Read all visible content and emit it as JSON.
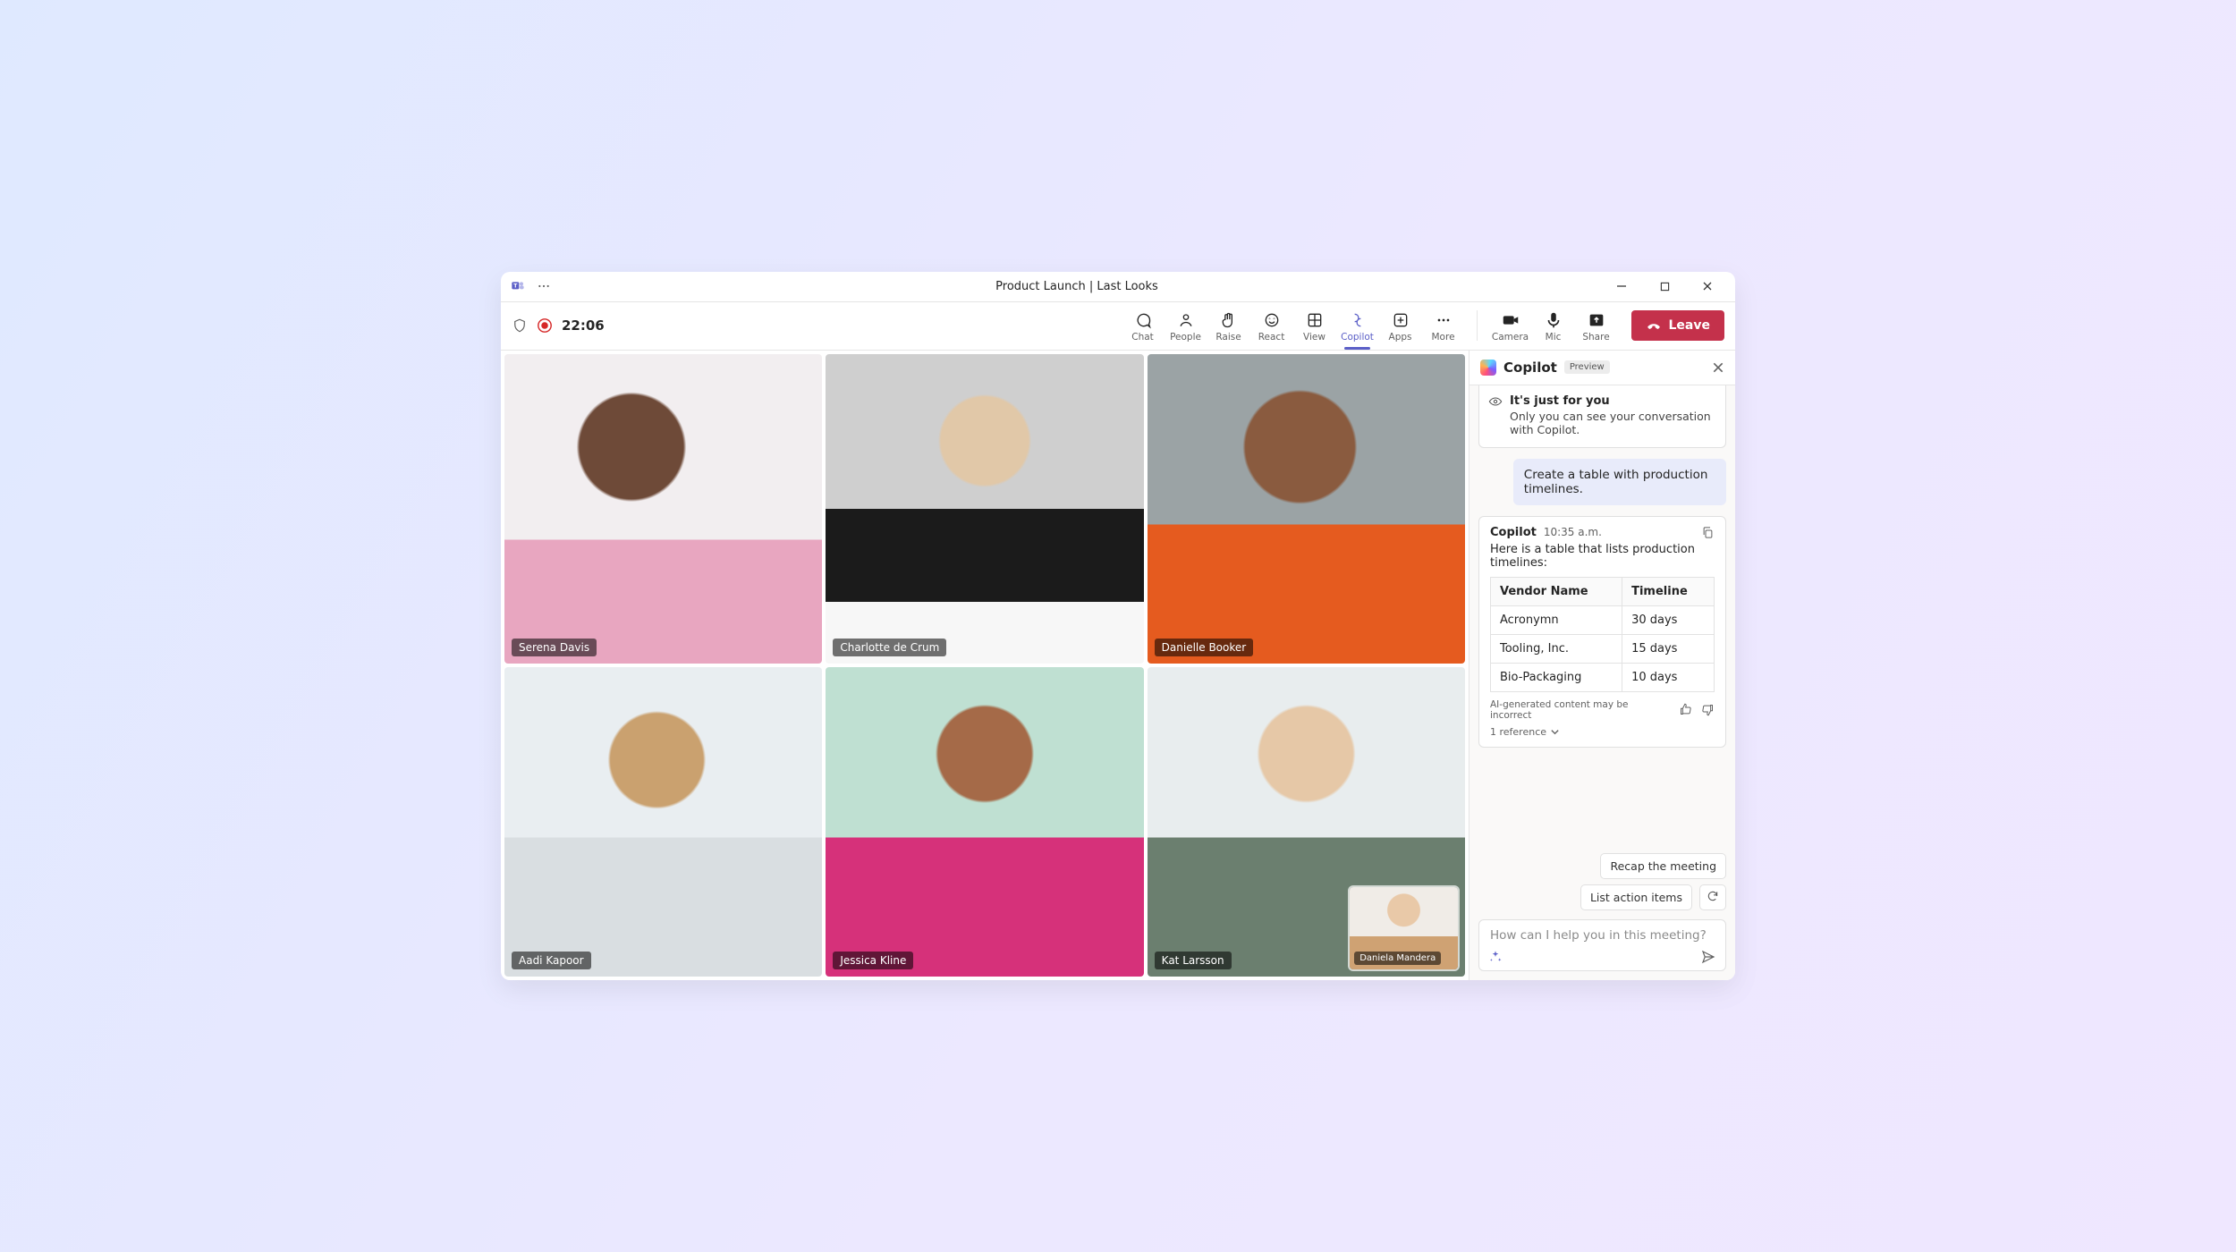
{
  "titlebar": {
    "meeting_title": "Product Launch | Last Looks"
  },
  "toolbar": {
    "timer": "22:06",
    "buttons": {
      "chat": "Chat",
      "people": "People",
      "raise": "Raise",
      "react": "React",
      "view": "View",
      "copilot": "Copilot",
      "apps": "Apps",
      "more": "More",
      "camera": "Camera",
      "mic": "Mic",
      "share": "Share"
    },
    "leave_label": "Leave"
  },
  "participants": [
    {
      "name": "Serena Davis"
    },
    {
      "name": "Charlotte de Crum"
    },
    {
      "name": "Danielle Booker"
    },
    {
      "name": "Aadi Kapoor"
    },
    {
      "name": "Jessica Kline"
    },
    {
      "name": "Kat Larsson",
      "pip_name": "Daniela Mandera"
    }
  ],
  "copilot": {
    "title": "Copilot",
    "preview_badge": "Preview",
    "info": {
      "title": "It's just for you",
      "subtitle": "Only you can see your conversation with Copilot."
    },
    "user_prompt": "Create a table with production timelines.",
    "response": {
      "from": "Copilot",
      "timestamp": "10:35 a.m.",
      "intro": "Here is a table that lists production timelines:",
      "table": {
        "headers": [
          "Vendor Name",
          "Timeline"
        ],
        "rows": [
          [
            "Acronymn",
            "30 days"
          ],
          [
            "Tooling, Inc.",
            "15 days"
          ],
          [
            "Bio-Packaging",
            "10 days"
          ]
        ]
      },
      "disclaimer": "AI-generated content may be incorrect",
      "references_label": "1 reference"
    },
    "suggestions": {
      "recap": "Recap the meeting",
      "action_items": "List action items"
    },
    "composer_placeholder": "How can I help you in this meeting?"
  }
}
